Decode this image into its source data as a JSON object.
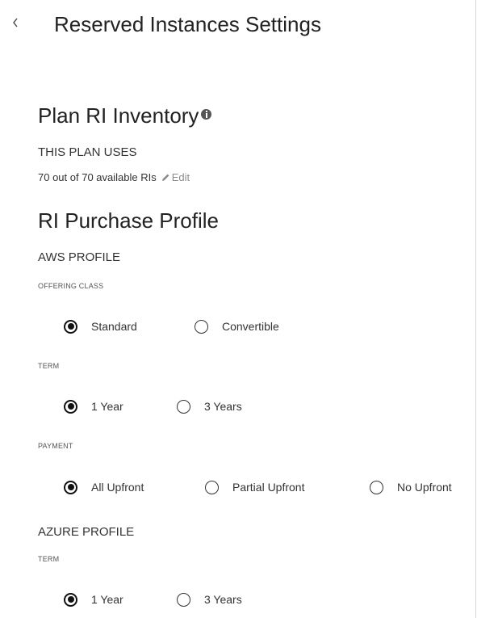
{
  "header": {
    "back_icon": "chevron-left-icon",
    "title": "Reserved Instances Settings"
  },
  "inventory": {
    "title": "Plan RI Inventory",
    "info_icon": "info-icon",
    "uses_label": "THIS PLAN USES",
    "usage_text": "70 out of 70 available RIs",
    "edit_label": "Edit",
    "edit_icon": "pencil-icon"
  },
  "purchase_profile": {
    "title": "RI Purchase Profile",
    "aws": {
      "label": "AWS PROFILE",
      "offering_class": {
        "label": "OFFERING CLASS",
        "options": [
          "Standard",
          "Convertible"
        ],
        "selected": "Standard"
      },
      "term": {
        "label": "TERM",
        "options": [
          "1 Year",
          "3 Years"
        ],
        "selected": "1 Year"
      },
      "payment": {
        "label": "PAYMENT",
        "options": [
          "All Upfront",
          "Partial Upfront",
          "No Upfront"
        ],
        "selected": "All Upfront"
      }
    },
    "azure": {
      "label": "AZURE PROFILE",
      "term": {
        "label": "TERM",
        "options": [
          "1 Year",
          "3 Years"
        ],
        "selected": "1 Year"
      }
    }
  }
}
